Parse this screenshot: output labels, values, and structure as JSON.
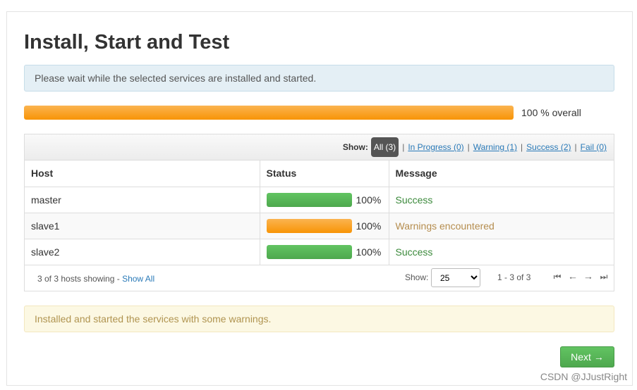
{
  "page": {
    "title": "Install, Start and Test",
    "info_message": "Please wait while the selected services are installed and started."
  },
  "overall_progress": {
    "percent": 100,
    "label": "100 % overall",
    "color": "#f89406"
  },
  "filters": {
    "show_label": "Show:",
    "items": [
      {
        "label": "All (3)",
        "active": true
      },
      {
        "label": "In Progress (0)",
        "active": false
      },
      {
        "label": "Warning (1)",
        "active": false
      },
      {
        "label": "Success (2)",
        "active": false
      },
      {
        "label": "Fail (0)",
        "active": false
      }
    ],
    "separator": "|"
  },
  "table": {
    "headers": [
      "Host",
      "Status",
      "Message"
    ],
    "rows": [
      {
        "host": "master",
        "percent": 100,
        "percent_label": "100%",
        "bar_color": "green",
        "message": "Success",
        "message_type": "success"
      },
      {
        "host": "slave1",
        "percent": 100,
        "percent_label": "100%",
        "bar_color": "orange",
        "message": "Warnings encountered",
        "message_type": "warning"
      },
      {
        "host": "slave2",
        "percent": 100,
        "percent_label": "100%",
        "bar_color": "green",
        "message": "Success",
        "message_type": "success"
      }
    ]
  },
  "pagination": {
    "hosts_showing": "3 of 3 hosts showing -",
    "show_all_link": "Show All",
    "show_label": "Show:",
    "page_size": "25",
    "range": "1 - 3 of 3",
    "icons": [
      "first-page-icon",
      "prev-page-icon",
      "next-page-icon",
      "last-page-icon"
    ]
  },
  "result": {
    "message": "Installed and started the services with some warnings."
  },
  "buttons": {
    "next_label": "Next →"
  },
  "watermark": "CSDN @JJustRight",
  "colors": {
    "success": "#5cb85c",
    "warning": "#f89406",
    "link": "#2a7ab8"
  }
}
